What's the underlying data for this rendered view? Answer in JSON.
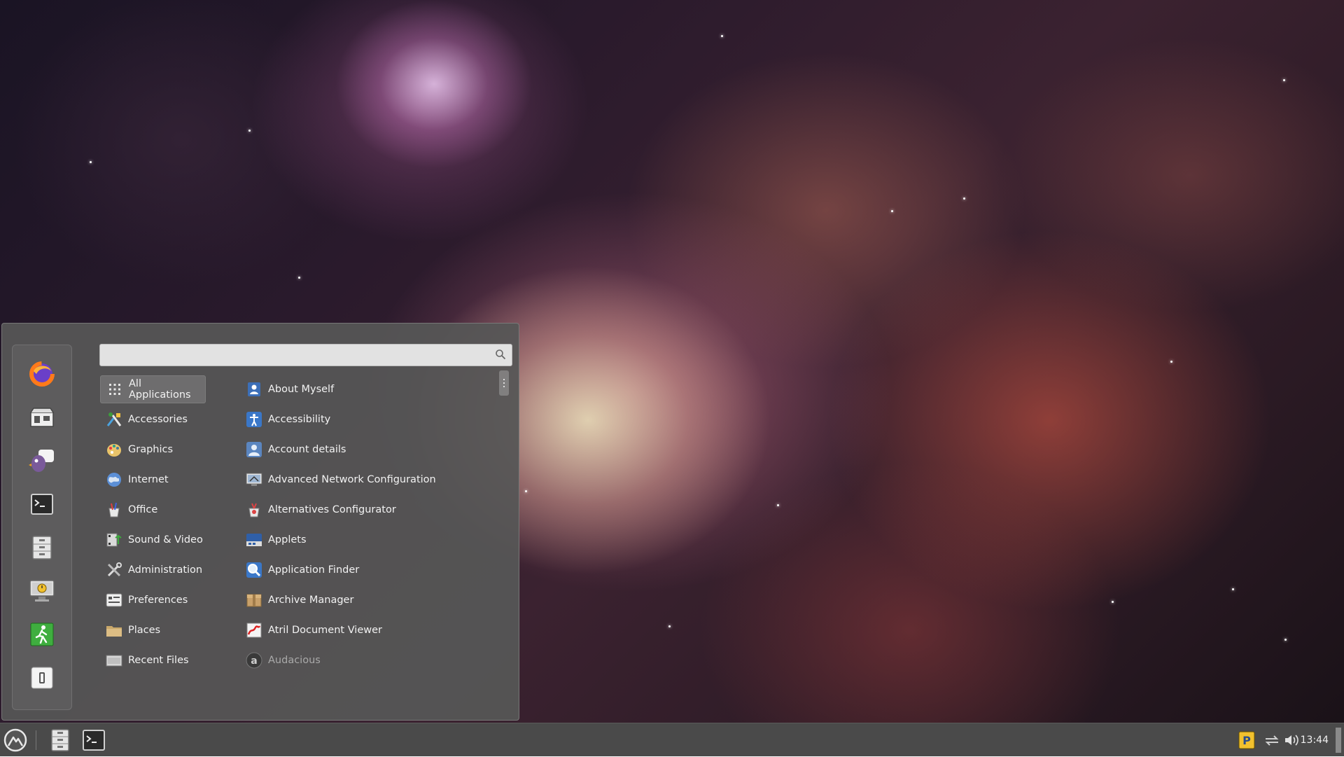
{
  "search": {
    "placeholder": "",
    "value": ""
  },
  "favorites": [
    {
      "name": "firefox",
      "icon": "firefox-icon"
    },
    {
      "name": "software-manager",
      "icon": "software-store-icon"
    },
    {
      "name": "pidgin",
      "icon": "pidgin-icon"
    },
    {
      "name": "terminal",
      "icon": "terminal-icon"
    },
    {
      "name": "files",
      "icon": "file-cabinet-icon"
    },
    {
      "name": "lock-screen",
      "icon": "lock-screen-icon"
    },
    {
      "name": "logout",
      "icon": "exit-icon"
    },
    {
      "name": "shutdown",
      "icon": "power-icon"
    }
  ],
  "categories": [
    {
      "label": "All Applications",
      "icon": "grid-icon",
      "selected": true
    },
    {
      "label": "Accessories",
      "icon": "accessories-icon"
    },
    {
      "label": "Graphics",
      "icon": "graphics-icon"
    },
    {
      "label": "Internet",
      "icon": "globe-icon"
    },
    {
      "label": "Office",
      "icon": "office-icon"
    },
    {
      "label": "Sound & Video",
      "icon": "multimedia-icon"
    },
    {
      "label": "Administration",
      "icon": "tools-icon"
    },
    {
      "label": "Preferences",
      "icon": "preferences-icon"
    },
    {
      "label": "Places",
      "icon": "folder-icon"
    },
    {
      "label": "Recent Files",
      "icon": "recent-files-icon"
    }
  ],
  "applications": [
    {
      "label": "About Myself",
      "icon": "about-me-icon"
    },
    {
      "label": "Accessibility",
      "icon": "accessibility-icon"
    },
    {
      "label": "Account details",
      "icon": "user-account-icon"
    },
    {
      "label": "Advanced Network Configuration",
      "icon": "network-icon"
    },
    {
      "label": "Alternatives Configurator",
      "icon": "alternatives-icon"
    },
    {
      "label": "Applets",
      "icon": "applets-icon"
    },
    {
      "label": "Application Finder",
      "icon": "magnifier-icon"
    },
    {
      "label": "Archive Manager",
      "icon": "archive-icon"
    },
    {
      "label": "Atril Document Viewer",
      "icon": "document-viewer-icon"
    },
    {
      "label": "Audacious",
      "icon": "audacious-icon",
      "dimmed": true
    }
  ],
  "panel": {
    "menu_icon": "linux-mint-menu-icon",
    "launchers": [
      "file-cabinet-icon",
      "terminal-icon"
    ],
    "tray": [
      "pidgin-tray-icon",
      "network-icon",
      "volume-icon"
    ],
    "clock": "13:44"
  }
}
